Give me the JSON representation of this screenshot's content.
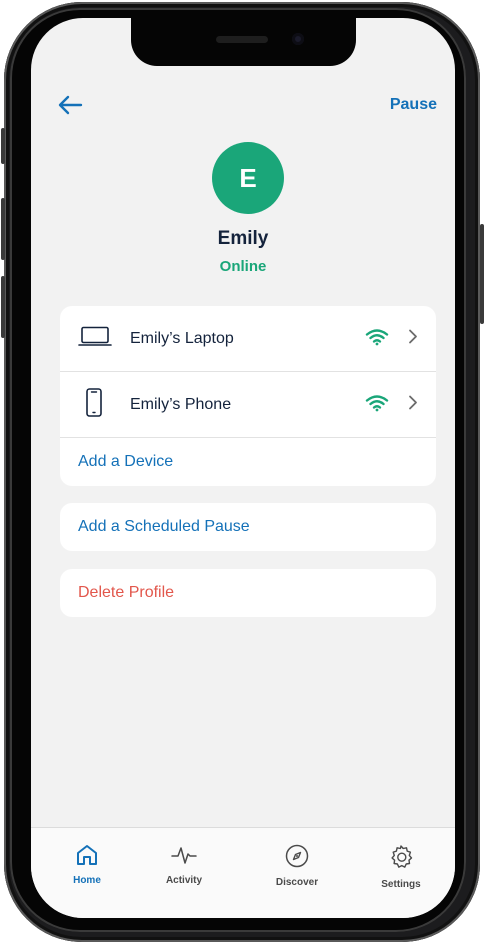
{
  "header": {
    "back_icon": "arrow-left-icon",
    "pause_label": "Pause"
  },
  "profile": {
    "initial": "E",
    "name": "Emily",
    "status": "Online",
    "avatar_color": "#1aa679"
  },
  "devices": [
    {
      "label": "Emily’s Laptop",
      "icon": "laptop-icon",
      "signal": "wifi-icon",
      "chevron": "chevron-right-icon"
    },
    {
      "label": "Emily’s Phone",
      "icon": "phone-icon",
      "signal": "wifi-icon",
      "chevron": "chevron-right-icon"
    }
  ],
  "actions": {
    "add_device": "Add a Device",
    "add_scheduled_pause": "Add a Scheduled Pause",
    "delete_profile": "Delete Profile"
  },
  "tabs": [
    {
      "label": "Home",
      "icon": "home-icon",
      "active": true
    },
    {
      "label": "Activity",
      "icon": "activity-icon",
      "active": false
    },
    {
      "label": "Discover",
      "icon": "compass-icon",
      "active": false
    },
    {
      "label": "Settings",
      "icon": "gear-icon",
      "active": false
    }
  ],
  "colors": {
    "accent": "#1471b8",
    "online": "#1aa679",
    "danger": "#e2574c",
    "text": "#14233c"
  }
}
